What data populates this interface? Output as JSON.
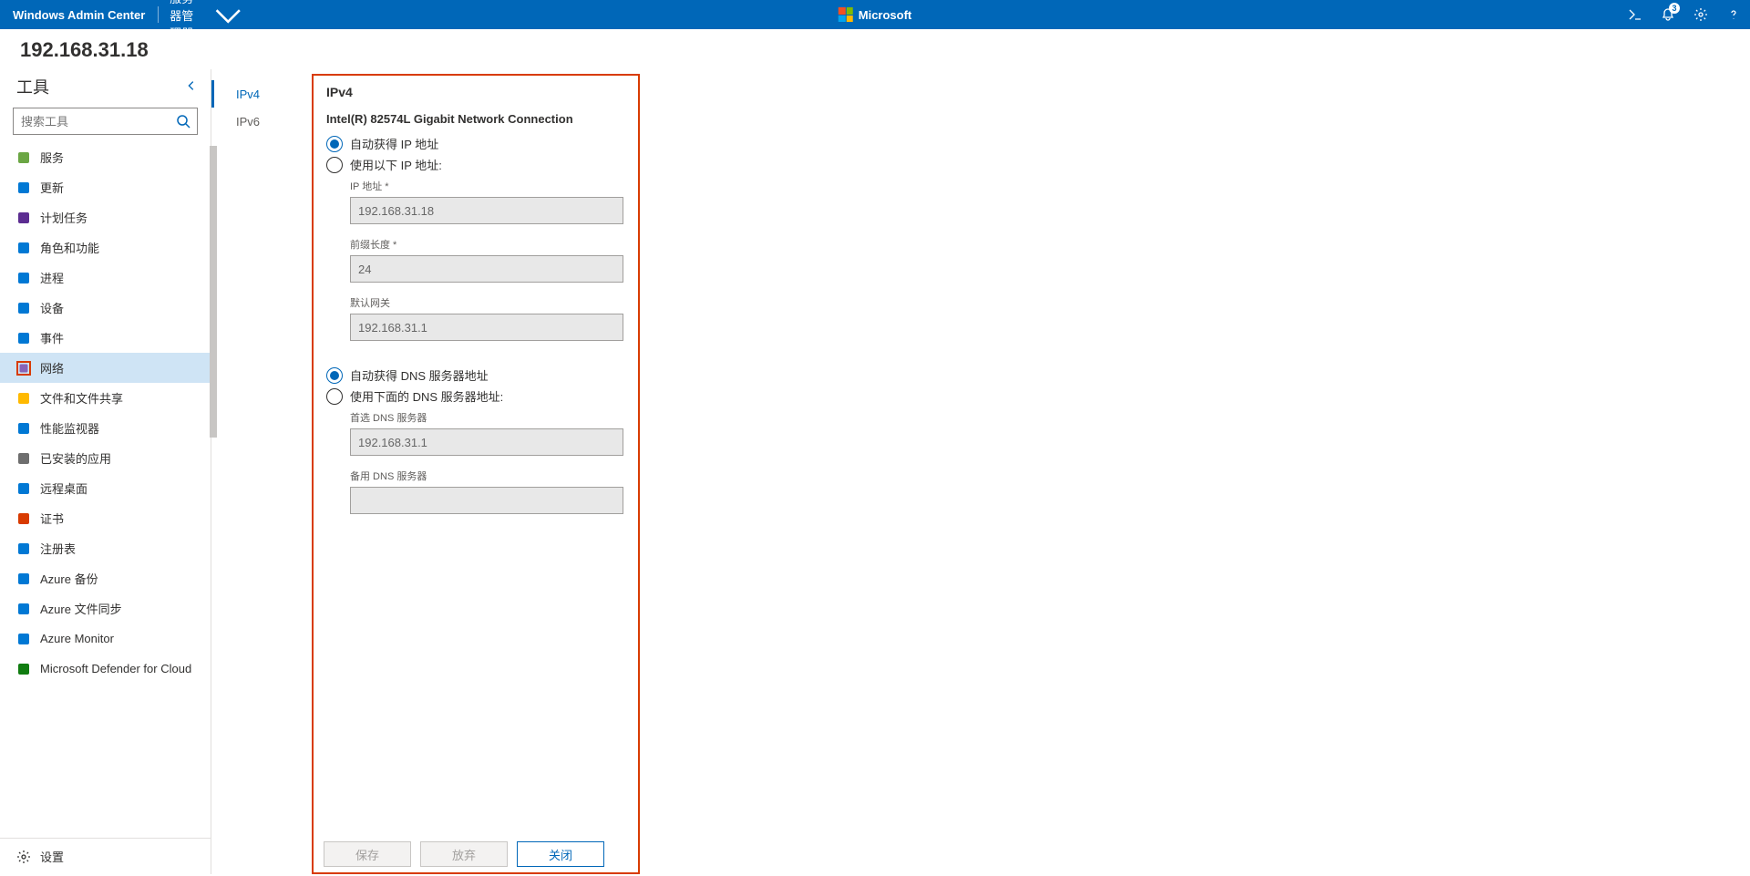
{
  "topbar": {
    "brand": "Windows Admin Center",
    "context": "服务器管理器",
    "ms": "Microsoft",
    "notif_count": "3"
  },
  "host": "192.168.31.18",
  "tools_header": "工具",
  "search_placeholder": "搜索工具",
  "tools": [
    {
      "label": "服务",
      "name": "services"
    },
    {
      "label": "更新",
      "name": "updates"
    },
    {
      "label": "计划任务",
      "name": "scheduled-tasks"
    },
    {
      "label": "角色和功能",
      "name": "roles-features"
    },
    {
      "label": "进程",
      "name": "processes"
    },
    {
      "label": "设备",
      "name": "devices"
    },
    {
      "label": "事件",
      "name": "events"
    },
    {
      "label": "网络",
      "name": "network",
      "active": true,
      "hi": true
    },
    {
      "label": "文件和文件共享",
      "name": "files"
    },
    {
      "label": "性能监视器",
      "name": "perfmon"
    },
    {
      "label": "已安装的应用",
      "name": "installed-apps"
    },
    {
      "label": "远程桌面",
      "name": "remote-desktop"
    },
    {
      "label": "证书",
      "name": "certificates"
    },
    {
      "label": "注册表",
      "name": "registry"
    },
    {
      "label": "Azure 备份",
      "name": "azure-backup"
    },
    {
      "label": "Azure 文件同步",
      "name": "azure-file-sync"
    },
    {
      "label": "Azure Monitor",
      "name": "azure-monitor"
    },
    {
      "label": "Microsoft Defender for Cloud",
      "name": "defender"
    }
  ],
  "settings_label": "设置",
  "subnav": {
    "ipv4": "IPv4",
    "ipv6": "IPv6"
  },
  "panel": {
    "title": "IPv4",
    "nic": "Intel(R) 82574L Gigabit Network Connection",
    "ip_auto": "自动获得 IP 地址",
    "ip_manual": "使用以下 IP 地址:",
    "ip_label": "IP 地址 *",
    "ip_value": "192.168.31.18",
    "prefix_label": "前缀长度 *",
    "prefix_value": "24",
    "gw_label": "默认网关",
    "gw_value": "192.168.31.1",
    "dns_auto": "自动获得 DNS 服务器地址",
    "dns_manual": "使用下面的 DNS 服务器地址:",
    "dns1_label": "首选 DNS 服务器",
    "dns1_value": "192.168.31.1",
    "dns2_label": "备用 DNS 服务器",
    "dns2_value": ""
  },
  "buttons": {
    "save": "保存",
    "discard": "放弃",
    "close": "关闭"
  }
}
